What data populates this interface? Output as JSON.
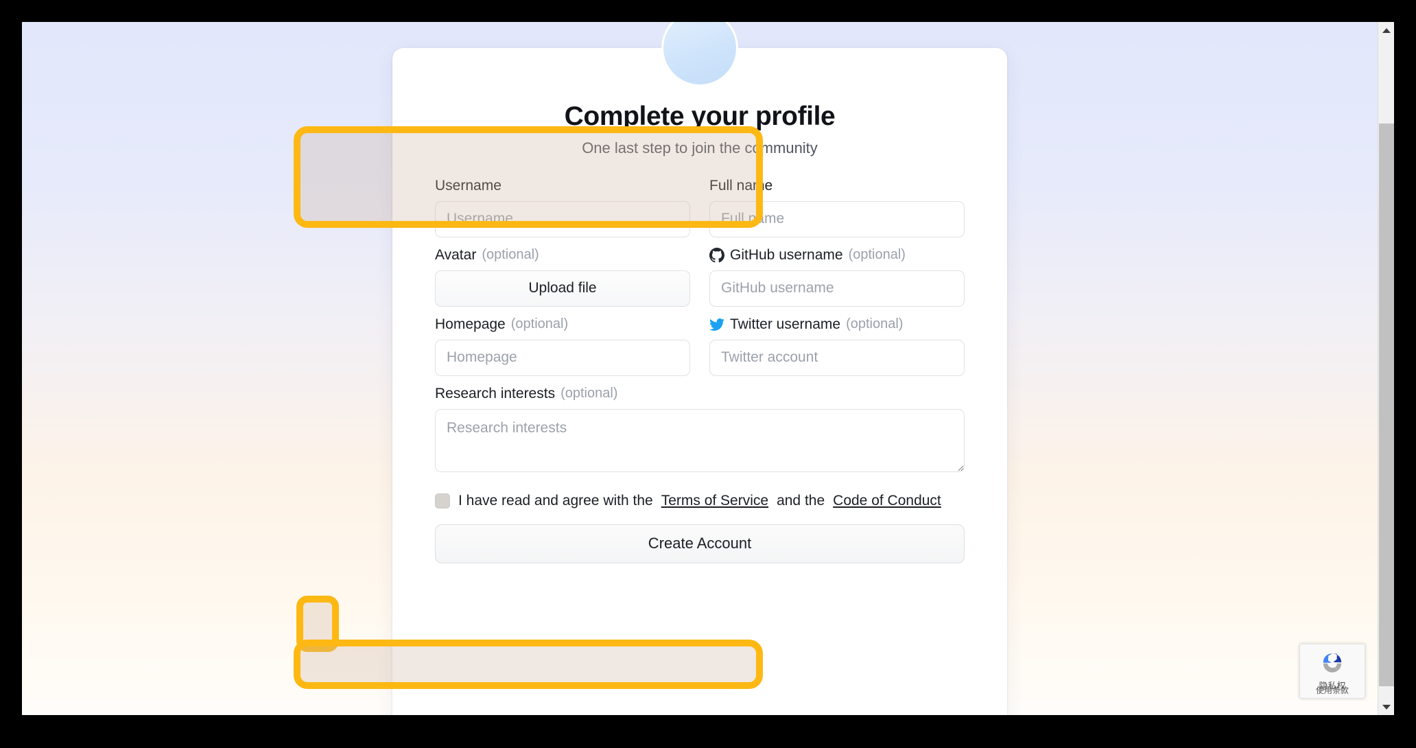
{
  "page": {
    "title": "Complete your profile",
    "subtitle": "One last step to join the community"
  },
  "form": {
    "username": {
      "label": "Username",
      "placeholder": "Username",
      "value": ""
    },
    "fullname": {
      "label": "Full name",
      "placeholder": "Full name",
      "value": ""
    },
    "avatar": {
      "label": "Avatar",
      "optional": "(optional)",
      "button": "Upload file"
    },
    "github": {
      "label": "GitHub username",
      "optional": "(optional)",
      "placeholder": "GitHub username",
      "value": "",
      "icon": "github-icon",
      "icon_color": "#24292f"
    },
    "homepage": {
      "label": "Homepage",
      "optional": "(optional)",
      "placeholder": "Homepage",
      "value": ""
    },
    "twitter": {
      "label": "Twitter username",
      "optional": "(optional)",
      "placeholder": "Twitter account",
      "value": "",
      "icon": "twitter-icon",
      "icon_color": "#1da1f2"
    },
    "research": {
      "label": "Research interests",
      "optional": "(optional)",
      "placeholder": "Research interests",
      "value": ""
    }
  },
  "agree": {
    "text_before": "I have read and agree with the",
    "terms_link": "Terms of Service",
    "text_middle": "and the",
    "conduct_link": "Code of Conduct",
    "checked": false
  },
  "submit": {
    "label": "Create Account"
  },
  "recaptcha": {
    "privacy": "隐私权",
    "terms": "使用条款"
  },
  "colors": {
    "highlight": "#FDB813",
    "bg_top": "#e2e7fb",
    "bg_bottom": "#fffdfa",
    "card": "#ffffff",
    "twitter_blue": "#1da1f2",
    "github_dark": "#24292f"
  },
  "scrollbar": {
    "up_arrow": "triangle-up-icon",
    "down_arrow": "triangle-down-icon"
  }
}
